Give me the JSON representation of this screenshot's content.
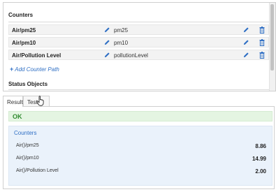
{
  "config": {
    "counters_title": "Counters",
    "counters": [
      {
        "name": "Air/pm25",
        "path": "pm25"
      },
      {
        "name": "Air/pm10",
        "path": "pm10"
      },
      {
        "name": "Air/Pollution Level",
        "path": "pollutionLevel"
      }
    ],
    "add_counter_path": "Add Counter Path",
    "status_objects_title": "Status Objects"
  },
  "tabs": [
    {
      "label": "Result",
      "active": true
    },
    {
      "label": "Test Data",
      "active": false
    }
  ],
  "result": {
    "status": "OK",
    "counters_heading": "Counters",
    "rows": [
      {
        "name": "Air()/pm25",
        "value": "8.86"
      },
      {
        "name": "Air()/pm10",
        "value": "14.99"
      },
      {
        "name": "Air()/Pollution Level",
        "value": "2.00"
      }
    ]
  },
  "colors": {
    "accent": "#2f6fc4",
    "ok_background": "#e4f5e2",
    "ok_text": "#2f8a2f",
    "counters_background": "#eaf2fb"
  },
  "icons": [
    "pencil-icon",
    "trash-icon",
    "plus-icon",
    "hand-cursor-icon"
  ]
}
